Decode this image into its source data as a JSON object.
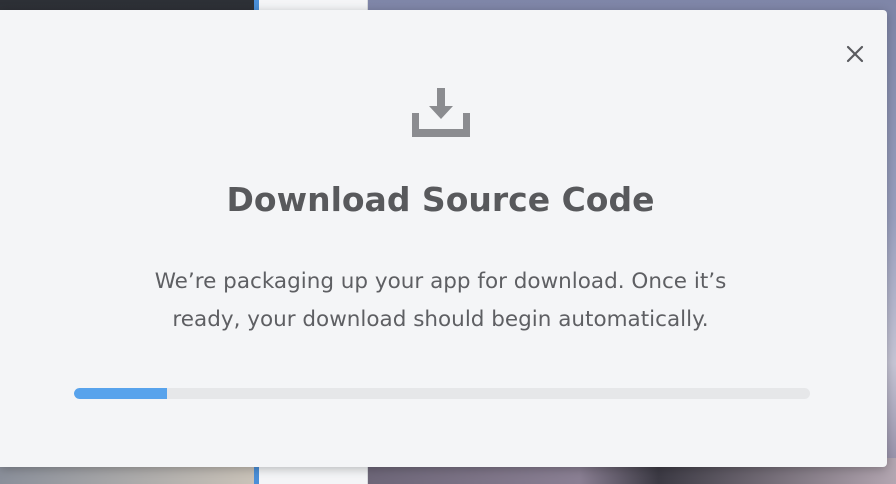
{
  "dialog": {
    "title": "Download Source Code",
    "message": "We’re packaging up your app for download. Once it’s ready, your download should begin automatically.",
    "close_icon": "close-icon",
    "header_icon": "download-tray-icon",
    "progress": {
      "fraction": 0.127,
      "fill_color": "#58a3ec",
      "track_color": "#e6e7e9"
    }
  },
  "colors": {
    "title_text": "#58595c",
    "body_text": "#5e5f63",
    "icon": "#8b8c90",
    "dialog_background": "#f4f5f7"
  }
}
